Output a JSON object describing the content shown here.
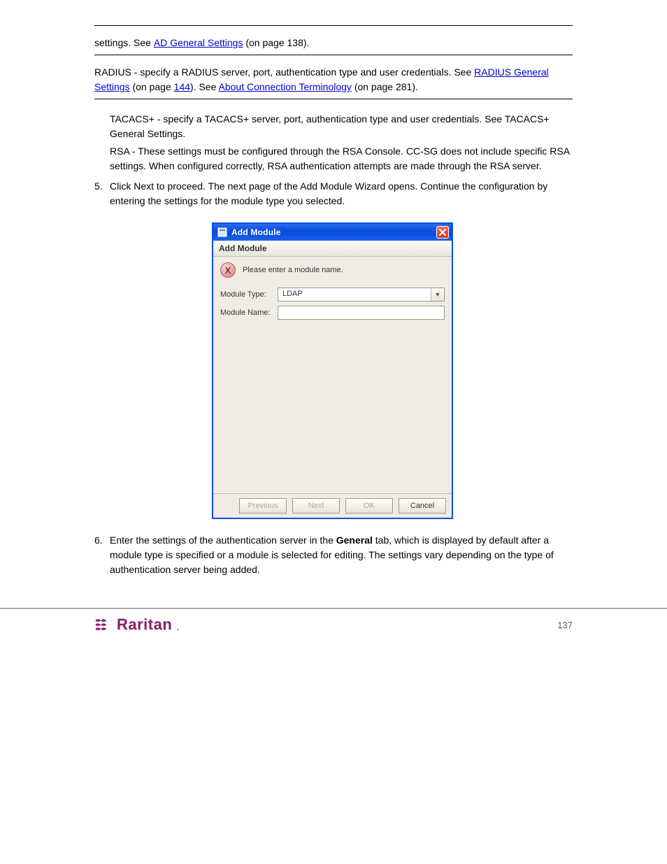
{
  "settings_row": {
    "prefix": "settings. See",
    "link": "AD General Settings",
    "suffix": "(on page 138)."
  },
  "radius_row": {
    "text": "RADIUS - specify a RADIUS server, port, authentication type and user credentials. See",
    "link1": "RADIUS General Settings",
    "mid": "(on page",
    "link2_part1": "144",
    "link2_part2": "). See",
    "link3": "About Connection Terminology",
    "suffix": "(on page 281)."
  },
  "steps": [
    "TACACS+ - specify a TACACS+ server, port, authentication type and user credentials. See TACACS+ General Settings.",
    "RSA - These settings must be configured through the RSA Console. CC-SG does not include specific RSA settings. When configured correctly, RSA authentication attempts are made through the RSA server.",
    "Click Next to proceed. The next page of the Add Module Wizard opens. Continue the configuration by entering the settings for the module type you selected."
  ],
  "dialog": {
    "title": "Add Module",
    "banner": "Add Module",
    "message": "Please enter a module name.",
    "module_type_label": "Module Type:",
    "module_type_value": "LDAP",
    "module_name_label": "Module Name:",
    "module_name_value": "",
    "buttons": {
      "previous": "Previous",
      "next": "Next",
      "ok": "OK",
      "cancel": "Cancel"
    }
  },
  "step6": {
    "num": "6.",
    "prefix": "Enter the settings of the authentication server in the ",
    "bold": "General",
    "suffix": " tab, which is displayed by default after a module type is specified or a module is selected for editing. The settings vary depending on the type of authentication server being added."
  },
  "brand": "Raritan",
  "page_number": "137"
}
